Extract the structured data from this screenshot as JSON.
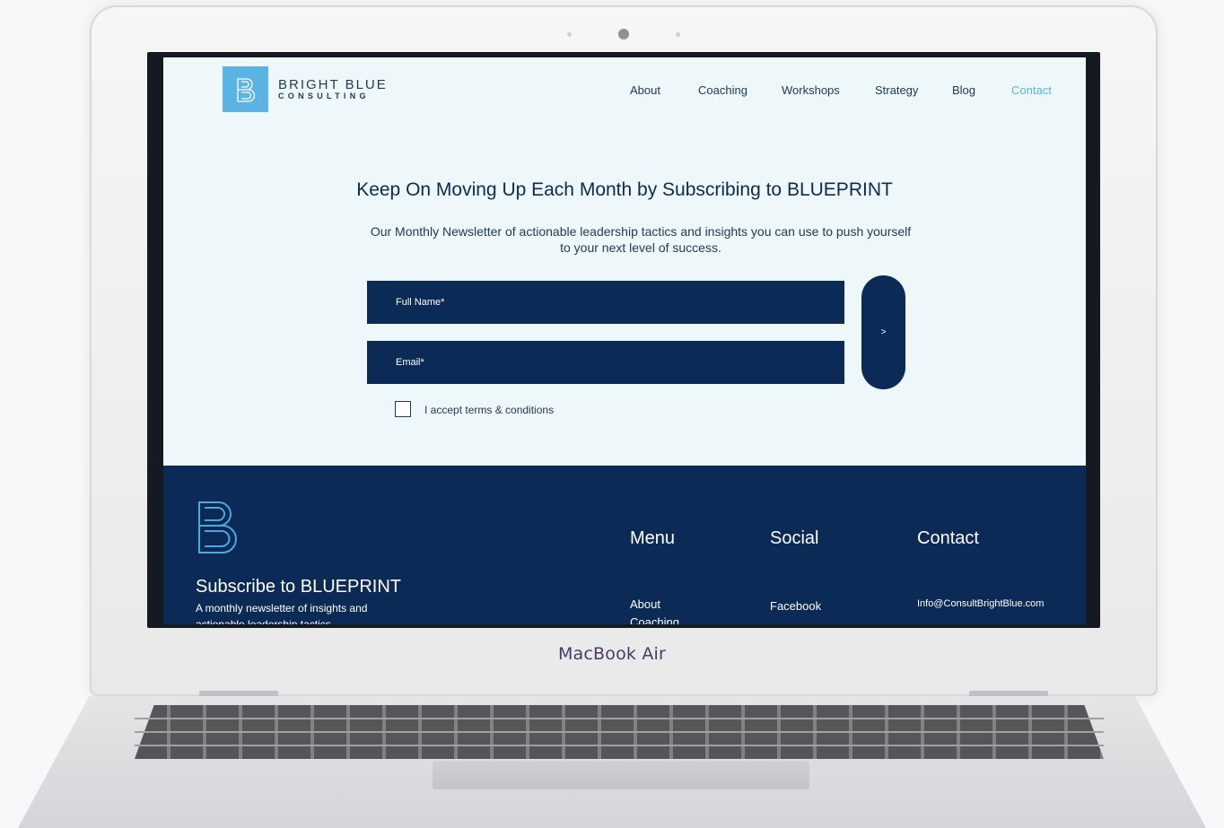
{
  "device": {
    "label": "MacBook Air"
  },
  "site": {
    "logo": {
      "line1": "BRIGHT BLUE",
      "line2": "CONSULTING"
    },
    "nav": [
      {
        "label": "About"
      },
      {
        "label": "Coaching"
      },
      {
        "label": "Workshops"
      },
      {
        "label": "Strategy"
      },
      {
        "label": "Blog"
      },
      {
        "label": "Contact",
        "active": true
      }
    ],
    "hero": {
      "headline": "Keep On Moving Up Each Month by Subscribing to BLUEPRINT",
      "subtext": "Our Monthly Newsletter of actionable leadership tactics and insights you can use to push yourself to your next level of success."
    },
    "form": {
      "name_placeholder": "Full Name*",
      "email_placeholder": "Email*",
      "submit_label": ">",
      "terms_label": "I accept terms & conditions",
      "terms_checked": false
    },
    "footer": {
      "title": "Subscribe to BLUEPRINT",
      "description": "A monthly newsletter of insights and actionable leadership tactics",
      "menu": {
        "heading": "Menu",
        "items": [
          "About",
          "Coaching"
        ]
      },
      "social": {
        "heading": "Social",
        "items": [
          "Facebook"
        ]
      },
      "contact": {
        "heading": "Contact",
        "email": "Info@ConsultBrightBlue.com"
      }
    }
  },
  "colors": {
    "navy": "#0b2a55",
    "accent": "#5ab3e3",
    "page_bg": "#eef7fa"
  }
}
